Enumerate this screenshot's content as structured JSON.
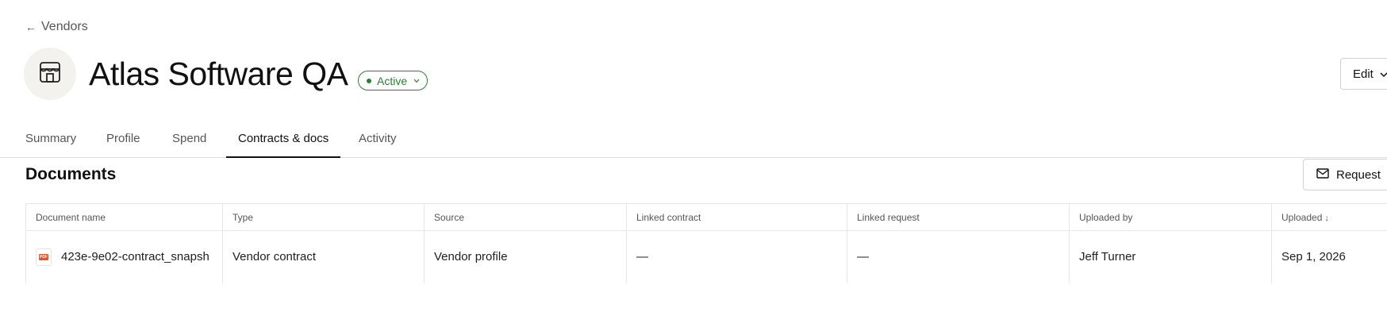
{
  "nav": {
    "back_label": "Vendors"
  },
  "vendor": {
    "name": "Atlas Software QA",
    "status": "Active",
    "status_color": "#2e7d32"
  },
  "actions": {
    "edit_label": "Edit",
    "request_label": "Request"
  },
  "tabs": [
    {
      "label": "Summary",
      "active": false
    },
    {
      "label": "Profile",
      "active": false
    },
    {
      "label": "Spend",
      "active": false
    },
    {
      "label": "Contracts & docs",
      "active": true
    },
    {
      "label": "Activity",
      "active": false
    }
  ],
  "documents": {
    "title": "Documents",
    "columns": [
      "Document name",
      "Type",
      "Source",
      "Linked contract",
      "Linked request",
      "Uploaded by",
      "Uploaded"
    ],
    "sort_column": "Uploaded",
    "sort_direction": "descending",
    "rows": [
      {
        "name": "423e-9e02-contract_snapsh",
        "type": "Vendor contract",
        "source": "Vendor profile",
        "linked_contract": "—",
        "linked_request": "—",
        "uploaded_by": "Jeff Turner",
        "uploaded": "Sep 1, 2026",
        "icon": "pdf-file-icon"
      }
    ]
  }
}
